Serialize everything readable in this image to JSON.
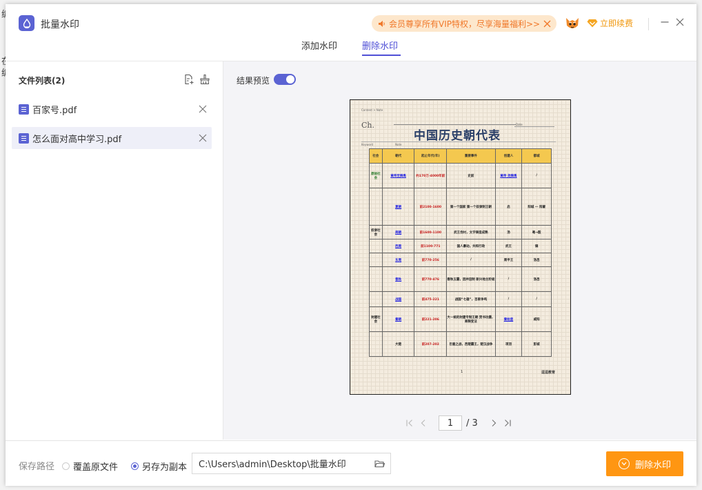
{
  "header": {
    "app_title": "批量水印",
    "promo_text": "会员尊享所有VIP特权，尽享海量福利>>",
    "renew_label": "立即续费"
  },
  "tabs": [
    {
      "label": "添加水印",
      "active": false
    },
    {
      "label": "删除水印",
      "active": true
    }
  ],
  "sidebar": {
    "title": "文件列表(2)",
    "files": [
      {
        "name": "百家号.pdf",
        "selected": false
      },
      {
        "name": "怎么面对高中学习.pdf",
        "selected": true
      }
    ]
  },
  "preview": {
    "label": "结果预览",
    "toggle_on": true,
    "page_current": "1",
    "page_total": "/ 3"
  },
  "document": {
    "title": "中国历史朝代表",
    "ch": "Ch.",
    "breadcrumb": "Content > Note",
    "date_label": "Date",
    "keyword_label": "Keyword",
    "note_label": "Note",
    "headers": [
      "社会",
      "朝代",
      "起止年代(年)",
      "重要事件",
      "创建人",
      "都城"
    ],
    "rows": [
      {
        "era": "原始社会",
        "dynasty": "黄帝至舜禹",
        "years": "约170万-4000年前",
        "event": "史前",
        "founder": "黄帝 尧舜禹",
        "capital": "/"
      },
      {
        "era": "",
        "dynasty": "夏朝",
        "years": "前2100-1600",
        "event": "第一个国家 第一个奴隶制王朝",
        "founder": "启",
        "capital": "阳城 一 阳翟"
      },
      {
        "era": "奴隶社会",
        "dynasty": "商朝",
        "years": "前1600-1100",
        "event": "武王伐纣，文字铸造成熟",
        "founder": "汤",
        "capital": "亳→殷"
      },
      {
        "era": "",
        "dynasty": "西周",
        "years": "前1100-771",
        "event": "国人暴动，共和行政",
        "founder": "武王",
        "capital": "镐"
      },
      {
        "era": "",
        "dynasty": "东周",
        "years": "前770-256",
        "event": "/",
        "founder": "周平王",
        "capital": "洛邑"
      },
      {
        "era": "",
        "dynasty": "春秋",
        "years": "前770-476",
        "event": "春秋五霸，因井田制 新兴地主阶级",
        "founder": "/",
        "capital": "洛邑"
      },
      {
        "era": "",
        "dynasty": "战国",
        "years": "前475-221",
        "event": "战国“七雄”，百家争鸣",
        "founder": "/",
        "capital": "/"
      },
      {
        "era": "封建社会",
        "dynasty": "秦朝",
        "years": "前221-206",
        "event": "大一统的封建专制王朝 焚书坑儒，商鞅变法",
        "founder": "秦始皇",
        "capital": "咸阳"
      },
      {
        "era": "",
        "dynasty": "大楚",
        "years": "前207-202",
        "event": "巨鹿之战，西楚霸王，楚汉战争",
        "founder": "项羽",
        "capital": "彭城"
      }
    ],
    "page_num": "1",
    "brand": "逗逗教育"
  },
  "footer": {
    "save_label": "保存路径",
    "overwrite_label": "覆盖原文件",
    "copy_label": "另存为副本",
    "copy_selected": true,
    "path": "C:\\Users\\admin\\Desktop\\批量水印",
    "remove_button": "删除水印"
  },
  "colors": {
    "accent": "#5b63d3",
    "orange": "#ff9612",
    "promo_bg": "#fde7cc"
  },
  "icons": [
    "app-logo-icon",
    "speaker-icon",
    "close-icon",
    "mascot-icon",
    "diamond-icon",
    "minimize-icon",
    "add-file-icon",
    "clear-list-icon",
    "pdf-icon",
    "first-page-icon",
    "prev-page-icon",
    "next-page-icon",
    "last-page-icon",
    "folder-icon"
  ]
}
